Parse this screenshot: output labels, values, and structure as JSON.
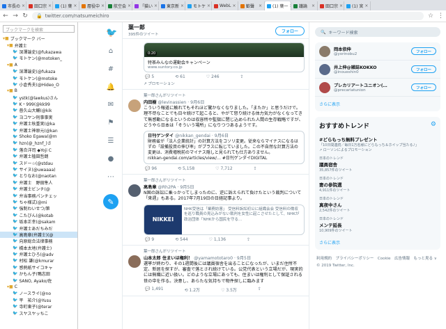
{
  "browser": {
    "tabs": [
      {
        "label": "市長の"
      },
      {
        "label": "田口宗"
      },
      {
        "label": "(1) 葉"
      },
      {
        "label": "層役中"
      },
      {
        "label": "航空会"
      },
      {
        "label": "「猫い"
      },
      {
        "label": "東京新"
      },
      {
        "label": "モトケ"
      },
      {
        "label": "WebL"
      },
      {
        "label": "歓聲"
      },
      {
        "label": "(1) 葉一"
      },
      {
        "label": "議論"
      },
      {
        "label": "田口宗"
      },
      {
        "label": "(1) 宮"
      }
    ],
    "url": "twitter.com/natsumeichiro"
  },
  "bookmarks": {
    "search_placeholder": "ブックマークを検索",
    "items": [
      {
        "label": "ブックマーク バー",
        "type": "folder"
      },
      {
        "label": "弁護士",
        "type": "folder"
      },
      {
        "label": "深澤諭史(@fukazawa",
        "type": "tw"
      },
      {
        "label": "モトケン(@motoken_",
        "type": "tw"
      },
      {
        "label": "A",
        "type": "folder"
      },
      {
        "label": "深澤諭史(@fukaza",
        "type": "tw"
      },
      {
        "label": "モトケン(@motoke",
        "type": "tw"
      },
      {
        "label": "小倉秀夫(@Hideo_O",
        "type": "tw"
      },
      {
        "label": "B",
        "type": "folder"
      },
      {
        "label": "ystk(@lawkus)さん",
        "type": "tw"
      },
      {
        "label": "K・999(@kk99",
        "type": "tw"
      },
      {
        "label": "普久山大輔(@kik",
        "type": "tw"
      },
      {
        "label": "ヨコヤン刑事事実",
        "type": "tw"
      },
      {
        "label": "弁護士秋重実(@ka",
        "type": "tw"
      },
      {
        "label": "弁護士神原元(@kan",
        "type": "tw"
      },
      {
        "label": "Shoko Egawa(@m",
        "type": "tw"
      },
      {
        "label": "hzn(@_hznf_)さ",
        "type": "tw"
      },
      {
        "label": "落合洋司 ◆Yoji C",
        "type": "tw"
      },
      {
        "label": "弁護士植田哲朗",
        "type": "tw"
      },
      {
        "label": "スドー☆(@stdau",
        "type": "tw"
      },
      {
        "label": "サイヌ(@uwaaaa)",
        "type": "tw"
      },
      {
        "label": "とりなお(@naotan",
        "type": "tw"
      },
      {
        "label": "弁護士　野田隼人",
        "type": "tw"
      },
      {
        "label": "弁護士ビンチ(@",
        "type": "tw"
      },
      {
        "label": "弁当事務パンチェッ",
        "type": "tw"
      },
      {
        "label": "ちゃ様式(@mi",
        "type": "tw"
      },
      {
        "label": "強制わいせつ/第",
        "type": "tw"
      },
      {
        "label": "こたびん(@kotab",
        "type": "tw"
      },
      {
        "label": "坂本正幸(@sakam",
        "type": "tw"
      },
      {
        "label": "弁護士あだちみだ",
        "type": "tw"
      },
      {
        "label": "高島章(弁護士)(@",
        "type": "tw",
        "selected": true
      },
      {
        "label": "向原総合法律事務",
        "type": "tw"
      },
      {
        "label": "橋本太地(弁護士)",
        "type": "tw"
      },
      {
        "label": "弁護士ひろ(@adv",
        "type": "tw"
      },
      {
        "label": "村松 謙(@kmurar",
        "type": "tw"
      },
      {
        "label": "感熱紙サイコキャ",
        "type": "tw"
      },
      {
        "label": "かもん子(鴨志田",
        "type": "tw"
      },
      {
        "label": "SANO, Ayako/佐",
        "type": "tw"
      },
      {
        "label": "C",
        "type": "folder"
      },
      {
        "label": "ノースライ(@no",
        "type": "tw"
      },
      {
        "label": "平　祐介(@Yusu",
        "type": "tw"
      },
      {
        "label": "寺町東子(@terar",
        "type": "tw"
      },
      {
        "label": "スヤスヤッちこ",
        "type": "tw"
      }
    ]
  },
  "profile": {
    "name": "葉一郎",
    "tweet_count": "395件のツイート",
    "follow_label": "フォロー"
  },
  "tweets": [
    {
      "card_title": "特茶みんなの運動会キャンペーン",
      "card_domain": "www.suntory.co.jp",
      "video_time": "0:20",
      "replies": "5",
      "retweets": "61",
      "likes": "246",
      "promo": "プロモーション"
    },
    {
      "rt": "葉一郎さんがリツイート",
      "name": "内田樹",
      "handle": "@levinassien · 9月6日",
      "text": "こういう報道に触れてもそれほど驚かなくなりました。「またか」と思うだけで。理不尽なことでも日々続けて起こると、やがて怒り続ける体力気力がなくなってきて無感動になるというのは収容所や監獄に閉じ込められた人間の生存戦略ですが、どうやら日本は「そういう場所」になりつつあるようです。",
      "quote_name": "日刊ゲンダイ",
      "quote_handle": "@nikkan_gendai · 9月6日",
      "quote_text": "財務省が「法人企業統計」の計算方法をコソリ変更。従来ならマイナスになるはずの「設備投資の伸び率」がプラスに転じていました。この不自然な計算方法の変更は、消費増税前のマイナス隠しと見られても仕方ありません。",
      "quote_link": "nikkan-gendai.com/articles/view/… #日刊ゲンダイDIGITAL",
      "replies": "96",
      "retweets": "5,158",
      "likes": "7,712"
    },
    {
      "rt": "葉一郎さんがリツイート",
      "name": "高島章",
      "handle": "@Rh2PA · 9月5日",
      "text": "N国の訴訟に乗っかってしまったのに、逆に訴えられて負けたという裁判について「来週」もある。2017年7月19日の日経記事より。",
      "card_logo": "NIKKEI",
      "card_text": "NHK受信は「業務妨害」 受信料訴訟初公に組織会会 受信料の徴収を巡り職員の見込みがない裁判を女性に起こさせたとして、NHKが政治団体「NHKから国民を守る…",
      "replies": "9",
      "retweets": "544",
      "likes": "1,136"
    },
    {
      "rt": "葉一郎さんがリツイート",
      "name": "山本太郎 住まいは権利！",
      "handle": "@yamamototaro0 · 9月5日",
      "text": "選挙が終わり、その1週間後には議員宿舎を出ることになったが、いまだ住所不定、新居を探すが、審査で落とされ続けている。公党代表という立場だが、現実的には無職に近い扱い。どのような立場にあっても、住まいは権利として保証される世の中を作る。決意し、あらたな気持ちで物件探しに臨みます",
      "replies": "1,491",
      "retweets": "1.2万",
      "likes": "3.5万"
    }
  ],
  "right": {
    "search_placeholder": "キーワード検索",
    "who_to_follow": [
      {
        "name": "岡本依伸",
        "handle": "@yorinobu2",
        "follow": "フォロー"
      },
      {
        "name": "井上伸@雑誌KOKKO",
        "handle": "@inoueshin0",
        "follow": "フォロー"
      },
      {
        "name": "プレカリアートユニオン(…",
        "handle": "@precariatunion",
        "follow": "フォロー"
      }
    ],
    "more_label": "さらに表示",
    "trends_title": "おすすめトレンド",
    "trends": [
      {
        "ctx": "",
        "name": "#どらもっち無料プレゼント",
        "count": "「10日間連続／毎日1万名様にどらもっち＆ホイップ当たる♪」",
        "promo": "ローソンによるプロモーション"
      },
      {
        "ctx": "日本のトレンド",
        "name": "議員宿舎",
        "count": "35,857件のツイート"
      },
      {
        "ctx": "日本のトレンド",
        "name": "妻の参院選",
        "count": "4,911件のツイート"
      },
      {
        "ctx": "日本のトレンド",
        "name": "真夜中さん",
        "count": "2,542件のツイート"
      },
      {
        "ctx": "日本のトレンド",
        "name": "メンテ延長",
        "count": "10,909件のツイート"
      }
    ],
    "trends_more": "さらに表示",
    "footer": "利用規約　プライバシーポリシー　Cookie　広告情報　もっと見る ∨　© 2019 Twitter, Inc."
  }
}
